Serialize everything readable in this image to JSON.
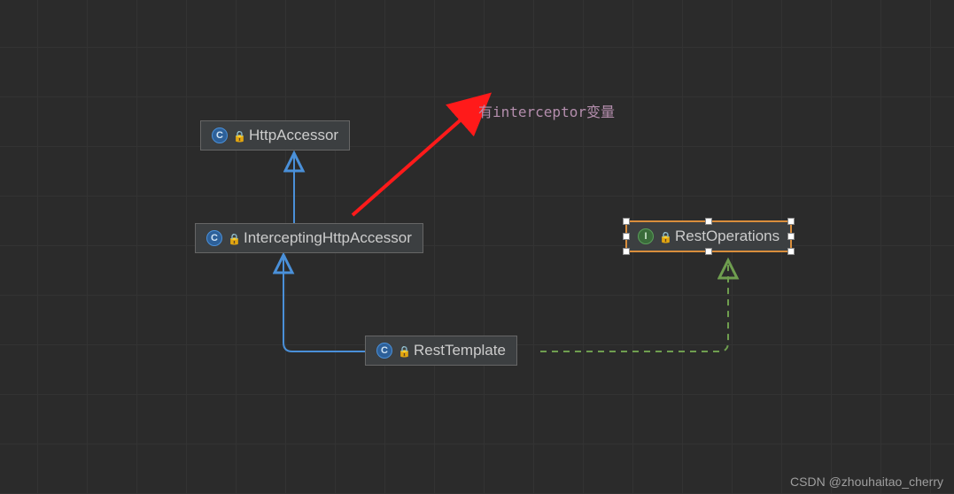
{
  "chart_data": {
    "type": "uml-class-diagram",
    "nodes": [
      {
        "id": "HttpAccessor",
        "kind": "class",
        "label": "HttpAccessor",
        "selected": false
      },
      {
        "id": "InterceptingHttpAccessor",
        "kind": "class",
        "label": "InterceptingHttpAccessor",
        "selected": false
      },
      {
        "id": "RestTemplate",
        "kind": "class",
        "label": "RestTemplate",
        "selected": false
      },
      {
        "id": "RestOperations",
        "kind": "interface",
        "label": "RestOperations",
        "selected": true
      }
    ],
    "edges": [
      {
        "from": "InterceptingHttpAccessor",
        "to": "HttpAccessor",
        "relation": "extends"
      },
      {
        "from": "RestTemplate",
        "to": "InterceptingHttpAccessor",
        "relation": "extends"
      },
      {
        "from": "RestTemplate",
        "to": "RestOperations",
        "relation": "implements"
      }
    ],
    "annotations": [
      {
        "text": "有interceptor变量",
        "target": "InterceptingHttpAccessor"
      }
    ]
  },
  "nodes": {
    "httpAccessor": {
      "label": "HttpAccessor"
    },
    "interceptingHttpAccessor": {
      "label": "InterceptingHttpAccessor"
    },
    "restTemplate": {
      "label": "RestTemplate"
    },
    "restOperations": {
      "label": "RestOperations"
    }
  },
  "annotation": {
    "text": "有interceptor变量"
  },
  "watermark": {
    "text": "CSDN @zhouhaitao_cherry"
  },
  "icons": {
    "classGlyph": "C",
    "interfaceGlyph": "I"
  },
  "colors": {
    "extends": "#4a90d9",
    "implements": "#6f9e4f",
    "selected": "#d98e3c",
    "annotation": "#b48ead",
    "arrow": "#ff1a1a"
  }
}
